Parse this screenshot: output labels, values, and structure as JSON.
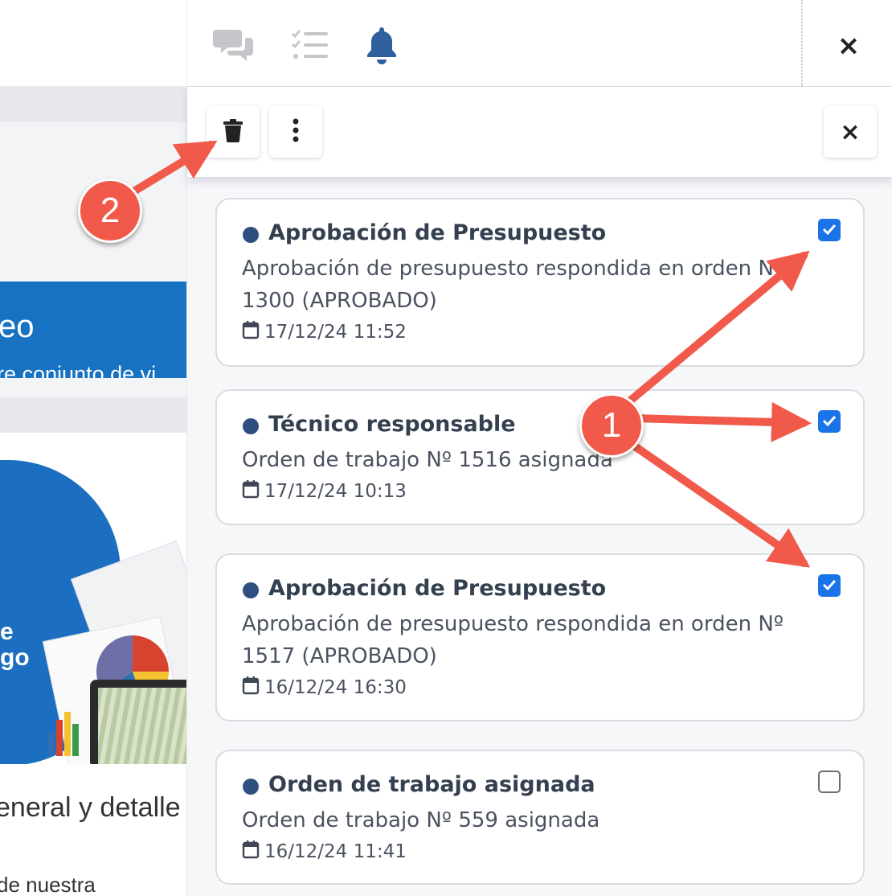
{
  "background_page": {
    "banner_title": "eo",
    "banner_subtitle": "re conjunto de vi",
    "promo_text_line1": "e",
    "promo_text_line2": "go",
    "paragraph_title": "eneral y detalle",
    "paragraph_line": "de nuestra"
  },
  "header": {
    "icons": [
      "chat-icon",
      "task-list-icon",
      "bell-icon"
    ],
    "close_label": "×",
    "accent_color": "#2f5f9f"
  },
  "toolbar": {
    "delete_icon": "trash-icon",
    "more_icon": "more-vertical-icon",
    "close_label": "×"
  },
  "notifications": [
    {
      "title": "Aprobación de Presupuesto",
      "body": "Aprobación de presupuesto respondida en orden Nº 1300 (APROBADO)",
      "date": "17/12/24 11:52",
      "checked": true
    },
    {
      "title": "Técnico responsable",
      "body": "Orden de trabajo Nº 1516 asignada",
      "date": "17/12/24 10:13",
      "checked": true
    },
    {
      "title": "Aprobación de Presupuesto",
      "body": "Aprobación de presupuesto respondida en orden Nº 1517 (APROBADO)",
      "date": "16/12/24 16:30",
      "checked": true
    },
    {
      "title": "Orden de trabajo asignada",
      "body": "Orden de trabajo Nº 559 asignada",
      "date": "16/12/24 11:41",
      "checked": false
    }
  ],
  "annotations": {
    "badge_1": "1",
    "badge_2": "2",
    "color": "#f15a4a"
  },
  "colors": {
    "checkbox_checked": "#1a73e8",
    "unread_dot": "#2f4f7f",
    "banner_blue": "#1872c2"
  }
}
